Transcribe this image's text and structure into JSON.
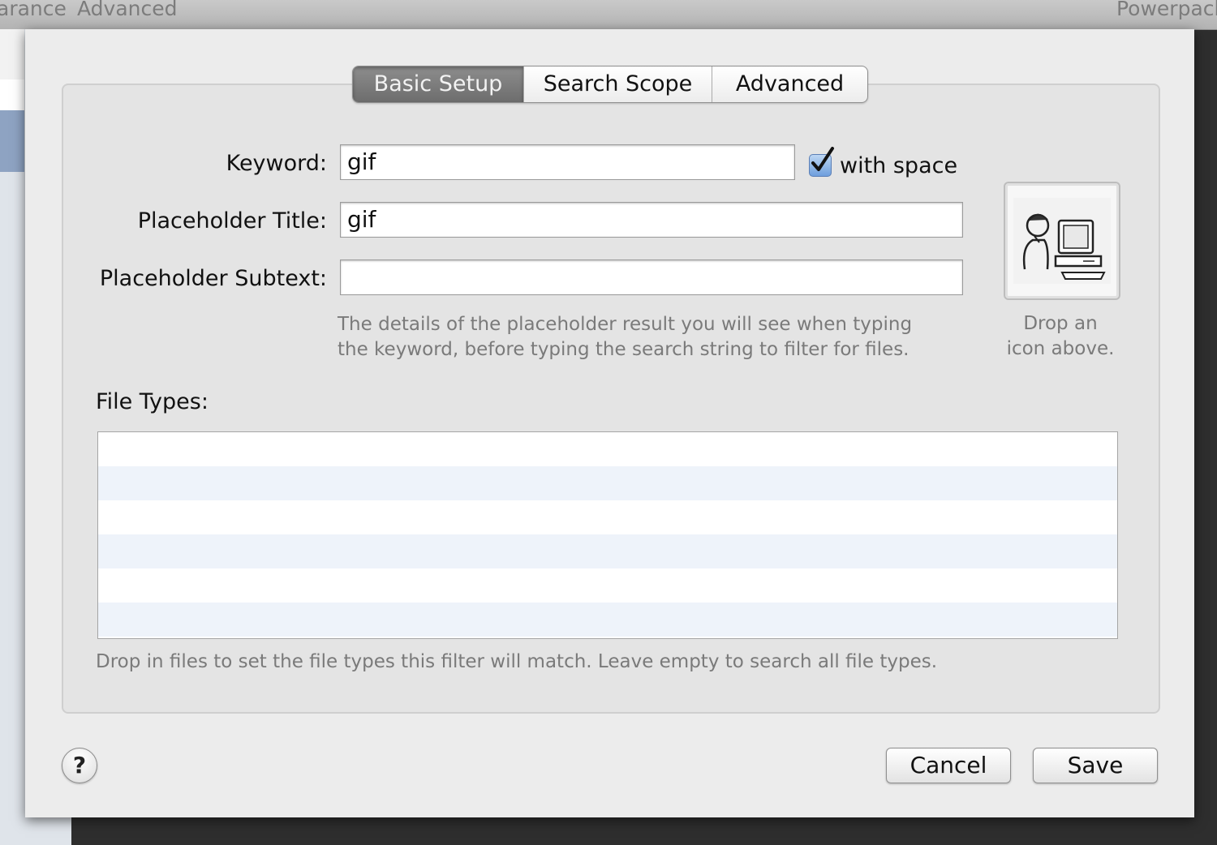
{
  "background_window": {
    "tabs": [
      "arance",
      "Advanced",
      "Powerpack"
    ]
  },
  "tabs": [
    {
      "label": "Basic Setup",
      "active": true
    },
    {
      "label": "Search Scope",
      "active": false
    },
    {
      "label": "Advanced",
      "active": false
    }
  ],
  "form": {
    "keyword_label": "Keyword:",
    "keyword_value": "gif",
    "with_space_label": "with space",
    "with_space_checked": true,
    "placeholder_title_label": "Placeholder Title:",
    "placeholder_title_value": "gif",
    "placeholder_subtext_label": "Placeholder Subtext:",
    "placeholder_subtext_value": "",
    "hint_line1": "The details of the placeholder result you will see when typing",
    "hint_line2": "the keyword, before typing the search string to filter for files."
  },
  "icon_well": {
    "icon": "person-at-computer-icon",
    "caption_line1": "Drop an",
    "caption_line2": "icon above."
  },
  "file_types": {
    "label": "File Types:",
    "rows": [],
    "hint": "Drop in files to set the file types this filter will match. Leave empty to search all file types."
  },
  "footer": {
    "help_label": "?",
    "cancel_label": "Cancel",
    "save_label": "Save"
  },
  "colors": {
    "active_tab": "#7a7a7a",
    "checkbox_blue": "#6e9fdd",
    "table_alt_row": "#eef3fa"
  }
}
